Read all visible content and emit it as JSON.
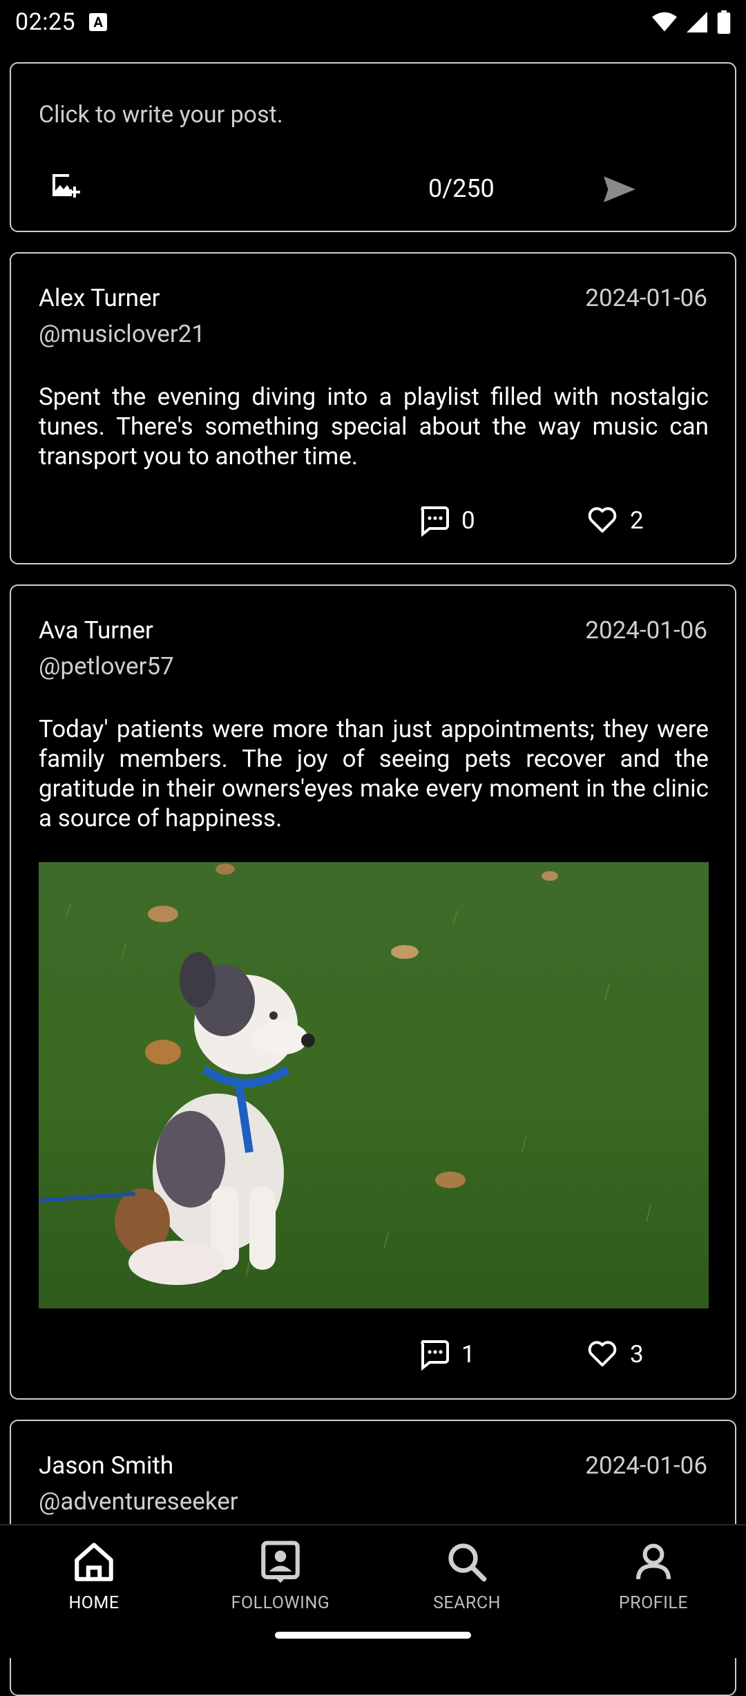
{
  "status": {
    "time": "02:25"
  },
  "composer": {
    "placeholder": "Click to write your post.",
    "counter": "0/250"
  },
  "posts": [
    {
      "name": "Alex Turner",
      "handle": "@musiclover21",
      "date": "2024-01-06",
      "text": "Spent the evening diving into a playlist filled with nostalgic tunes. There's something special about the way music can transport you to another time.",
      "comments": "0",
      "likes": "2"
    },
    {
      "name": "Ava Turner",
      "handle": "@petlover57",
      "date": "2024-01-06",
      "text": "Today' patients were more than just appointments; they were family members. The joy of seeing pets recover and the gratitude in their owners'eyes make every moment in the clinic a source of happiness.",
      "image": "puppy-on-grass",
      "comments": "1",
      "likes": "3"
    },
    {
      "name": "Jason Smith",
      "handle": "@adventureseeker",
      "date": "2024-01-06"
    }
  ],
  "nav": {
    "home": "HOME",
    "following": "FOLLOWING",
    "search": "SEARCH",
    "profile": "PROFILE"
  },
  "colors": {
    "background": "#000000",
    "border": "#cfcfcf",
    "text": "#ffffff",
    "muted": "#bdbdbd"
  }
}
